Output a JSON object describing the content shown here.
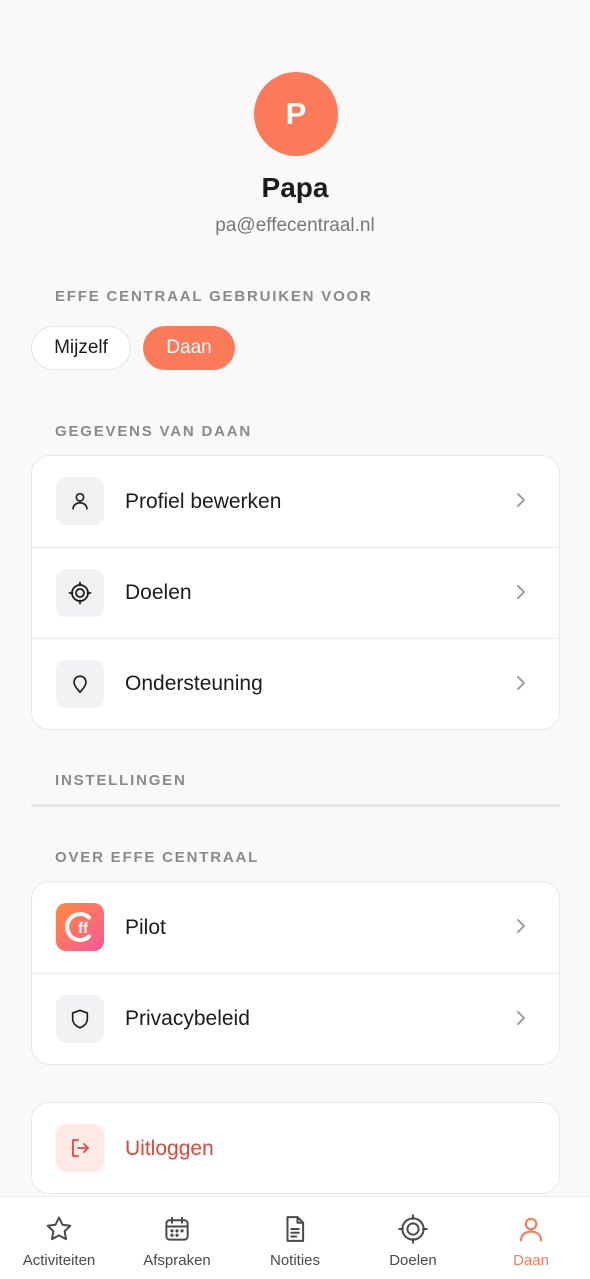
{
  "profile": {
    "initial": "P",
    "name": "Papa",
    "email": "pa@effecentraal.nl"
  },
  "use_for": {
    "title": "EFFE CENTRAAL GEBRUIKEN VOOR",
    "chips": [
      {
        "label": "Mijzelf",
        "selected": false
      },
      {
        "label": "Daan",
        "selected": true
      }
    ]
  },
  "details": {
    "title": "GEGEVENS VAN DAAN",
    "items": [
      {
        "label": "Profiel bewerken",
        "icon": "person-icon"
      },
      {
        "label": "Doelen",
        "icon": "target-icon"
      },
      {
        "label": "Ondersteuning",
        "icon": "location-pin-icon"
      }
    ]
  },
  "settings": {
    "title": "INSTELLINGEN"
  },
  "about": {
    "title": "OVER EFFE CENTRAAL",
    "items": [
      {
        "label": "Pilot",
        "icon": "effe-centraal-logo-icon",
        "logo_text": "ff"
      },
      {
        "label": "Privacybeleid",
        "icon": "shield-icon"
      }
    ]
  },
  "logout": {
    "label": "Uitloggen",
    "icon": "logout-icon"
  },
  "tabbar": {
    "tabs": [
      {
        "label": "Activiteiten",
        "icon": "star-icon",
        "active": false
      },
      {
        "label": "Afspraken",
        "icon": "calendar-icon",
        "active": false
      },
      {
        "label": "Notities",
        "icon": "document-icon",
        "active": false
      },
      {
        "label": "Doelen",
        "icon": "target-icon",
        "active": false
      },
      {
        "label": "Daan",
        "icon": "person-icon",
        "active": true
      }
    ]
  },
  "colors": {
    "accent": "#fb7a5a",
    "danger": "#e0463d",
    "background": "#f9f9f9"
  }
}
